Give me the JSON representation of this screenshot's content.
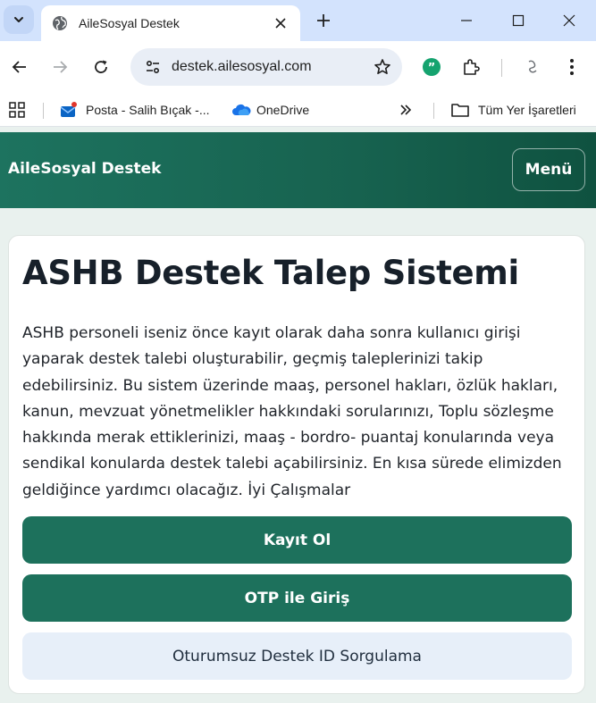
{
  "browser": {
    "tab_title": "AileSosyal Destek",
    "url": "destek.ailesosyal.com",
    "bookmarks": [
      {
        "label": "Posta - Salih Bıçak -..."
      },
      {
        "label": "OneDrive"
      }
    ],
    "all_bookmarks_label": "Tüm Yer İşaretleri",
    "colors": {
      "tabstrip": "#d3e3fd",
      "omnibox": "#e9eef6"
    }
  },
  "header": {
    "brand": "AileSosyal Destek",
    "menu_label": "Menü",
    "color": "#1d735f"
  },
  "main": {
    "title": "ASHB Destek Talep Sistemi",
    "description": "ASHB personeli iseniz önce kayıt olarak daha sonra kullanıcı girişi yaparak destek talebi oluşturabilir, geçmiş taleplerinizi takip edebilirsiniz. Bu sistem üzerinde maaş, personel hakları, özlük hakları, kanun, mevzuat yönetmelikler hakkındaki sorularınızı, Toplu sözleşme hakkında merak ettiklerinizi, maaş - bordro- puantaj konularında veya sendikal konularda destek talebi açabilirsiniz. En kısa sürede elimizden geldiğince yardımcı olacağız. İyi Çalışmalar",
    "register_label": "Kayıt Ol",
    "otp_label": "OTP ile Giriş",
    "query_label": "Oturumsuz Destek ID Sorgulama",
    "primary_color": "#1d715c",
    "secondary_color": "#e7eff9"
  }
}
